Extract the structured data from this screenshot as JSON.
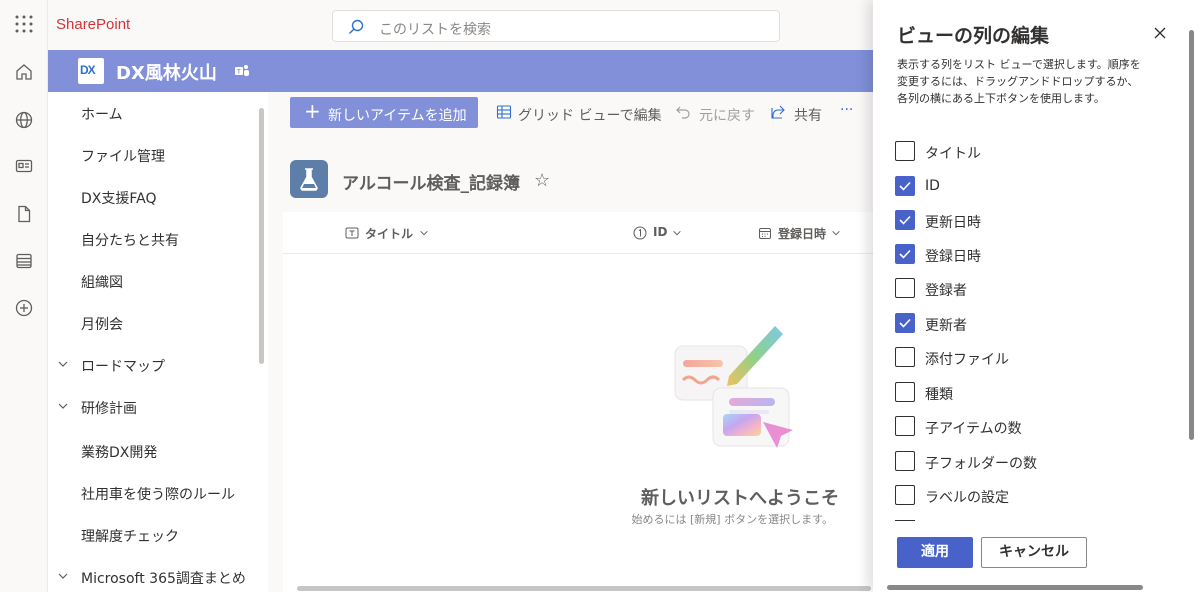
{
  "app": {
    "brand": "SharePoint"
  },
  "search": {
    "placeholder": "このリストを検索"
  },
  "site": {
    "logo_text": "DX",
    "title": "DX風林火山"
  },
  "rail": {
    "icons": [
      "home-icon",
      "globe-icon",
      "news-icon",
      "document-icon",
      "list-icon",
      "add-icon"
    ]
  },
  "nav": {
    "items": [
      {
        "label": "ホーム",
        "expandable": false
      },
      {
        "label": "ファイル管理",
        "expandable": false
      },
      {
        "label": "DX支援FAQ",
        "expandable": false
      },
      {
        "label": "自分たちと共有",
        "expandable": false
      },
      {
        "label": "組織図",
        "expandable": false
      },
      {
        "label": "月例会",
        "expandable": false
      },
      {
        "label": "ロードマップ",
        "expandable": true
      },
      {
        "label": "研修計画",
        "expandable": true
      },
      {
        "label": "業務DX開発",
        "expandable": false
      },
      {
        "label": "社用車を使う際のルール",
        "expandable": false
      },
      {
        "label": "理解度チェック",
        "expandable": false
      },
      {
        "label": "Microsoft 365調査まとめ",
        "expandable": true
      }
    ]
  },
  "commandbar": {
    "new_item": "新しいアイテムを追加",
    "grid_edit": "グリッド ビューで編集",
    "undo": "元に戻す",
    "share": "共有",
    "more": "···"
  },
  "list": {
    "title": "アルコール検査_記録簿",
    "columns": [
      {
        "label": "タイトル",
        "icon": "text-column-icon"
      },
      {
        "label": "ID",
        "icon": "number-column-icon"
      },
      {
        "label": "登録日時",
        "icon": "calendar-column-icon"
      }
    ],
    "empty_title": "新しいリストへようこそ",
    "empty_subtitle": "始めるには [新規] ボタンを選択します。"
  },
  "panel": {
    "title": "ビューの列の編集",
    "description": "表示する列をリスト ビューで選択します。順序を変更するには、ドラッグアンドドロップするか、各列の横にある上下ボタンを使用します。",
    "columns": [
      {
        "label": "タイトル",
        "checked": false
      },
      {
        "label": "ID",
        "checked": true
      },
      {
        "label": "更新日時",
        "checked": true
      },
      {
        "label": "登録日時",
        "checked": true
      },
      {
        "label": "登録者",
        "checked": false
      },
      {
        "label": "更新者",
        "checked": true
      },
      {
        "label": "添付ファイル",
        "checked": false
      },
      {
        "label": "種類",
        "checked": false
      },
      {
        "label": "子アイテムの数",
        "checked": false
      },
      {
        "label": "子フォルダーの数",
        "checked": false
      },
      {
        "label": "ラベルの設定",
        "checked": false
      }
    ],
    "apply": "適用",
    "cancel": "キャンセル"
  },
  "colors": {
    "accent": "#4862c9",
    "site_header": "#8190d9",
    "brand": "#d13438"
  }
}
